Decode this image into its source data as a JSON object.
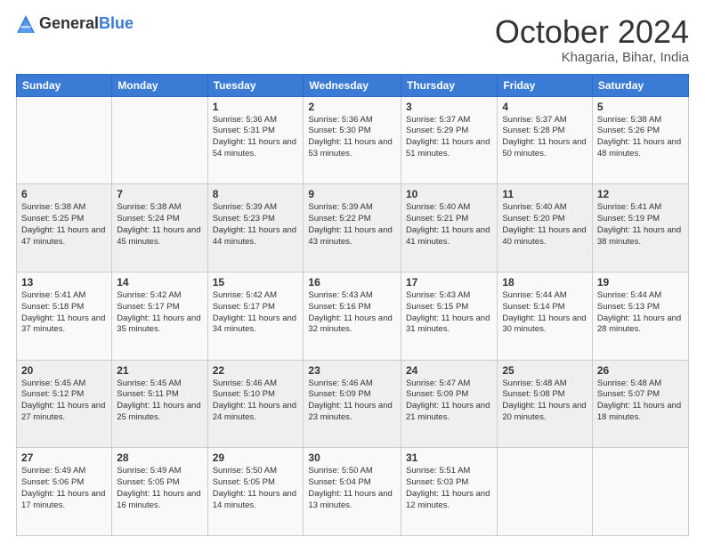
{
  "header": {
    "logo_general": "General",
    "logo_blue": "Blue",
    "month_title": "October 2024",
    "location": "Khagaria, Bihar, India"
  },
  "days_of_week": [
    "Sunday",
    "Monday",
    "Tuesday",
    "Wednesday",
    "Thursday",
    "Friday",
    "Saturday"
  ],
  "weeks": [
    [
      {
        "day": "",
        "info": ""
      },
      {
        "day": "",
        "info": ""
      },
      {
        "day": "1",
        "info": "Sunrise: 5:36 AM\nSunset: 5:31 PM\nDaylight: 11 hours and 54 minutes."
      },
      {
        "day": "2",
        "info": "Sunrise: 5:36 AM\nSunset: 5:30 PM\nDaylight: 11 hours and 53 minutes."
      },
      {
        "day": "3",
        "info": "Sunrise: 5:37 AM\nSunset: 5:29 PM\nDaylight: 11 hours and 51 minutes."
      },
      {
        "day": "4",
        "info": "Sunrise: 5:37 AM\nSunset: 5:28 PM\nDaylight: 11 hours and 50 minutes."
      },
      {
        "day": "5",
        "info": "Sunrise: 5:38 AM\nSunset: 5:26 PM\nDaylight: 11 hours and 48 minutes."
      }
    ],
    [
      {
        "day": "6",
        "info": "Sunrise: 5:38 AM\nSunset: 5:25 PM\nDaylight: 11 hours and 47 minutes."
      },
      {
        "day": "7",
        "info": "Sunrise: 5:38 AM\nSunset: 5:24 PM\nDaylight: 11 hours and 45 minutes."
      },
      {
        "day": "8",
        "info": "Sunrise: 5:39 AM\nSunset: 5:23 PM\nDaylight: 11 hours and 44 minutes."
      },
      {
        "day": "9",
        "info": "Sunrise: 5:39 AM\nSunset: 5:22 PM\nDaylight: 11 hours and 43 minutes."
      },
      {
        "day": "10",
        "info": "Sunrise: 5:40 AM\nSunset: 5:21 PM\nDaylight: 11 hours and 41 minutes."
      },
      {
        "day": "11",
        "info": "Sunrise: 5:40 AM\nSunset: 5:20 PM\nDaylight: 11 hours and 40 minutes."
      },
      {
        "day": "12",
        "info": "Sunrise: 5:41 AM\nSunset: 5:19 PM\nDaylight: 11 hours and 38 minutes."
      }
    ],
    [
      {
        "day": "13",
        "info": "Sunrise: 5:41 AM\nSunset: 5:18 PM\nDaylight: 11 hours and 37 minutes."
      },
      {
        "day": "14",
        "info": "Sunrise: 5:42 AM\nSunset: 5:17 PM\nDaylight: 11 hours and 35 minutes."
      },
      {
        "day": "15",
        "info": "Sunrise: 5:42 AM\nSunset: 5:17 PM\nDaylight: 11 hours and 34 minutes."
      },
      {
        "day": "16",
        "info": "Sunrise: 5:43 AM\nSunset: 5:16 PM\nDaylight: 11 hours and 32 minutes."
      },
      {
        "day": "17",
        "info": "Sunrise: 5:43 AM\nSunset: 5:15 PM\nDaylight: 11 hours and 31 minutes."
      },
      {
        "day": "18",
        "info": "Sunrise: 5:44 AM\nSunset: 5:14 PM\nDaylight: 11 hours and 30 minutes."
      },
      {
        "day": "19",
        "info": "Sunrise: 5:44 AM\nSunset: 5:13 PM\nDaylight: 11 hours and 28 minutes."
      }
    ],
    [
      {
        "day": "20",
        "info": "Sunrise: 5:45 AM\nSunset: 5:12 PM\nDaylight: 11 hours and 27 minutes."
      },
      {
        "day": "21",
        "info": "Sunrise: 5:45 AM\nSunset: 5:11 PM\nDaylight: 11 hours and 25 minutes."
      },
      {
        "day": "22",
        "info": "Sunrise: 5:46 AM\nSunset: 5:10 PM\nDaylight: 11 hours and 24 minutes."
      },
      {
        "day": "23",
        "info": "Sunrise: 5:46 AM\nSunset: 5:09 PM\nDaylight: 11 hours and 23 minutes."
      },
      {
        "day": "24",
        "info": "Sunrise: 5:47 AM\nSunset: 5:09 PM\nDaylight: 11 hours and 21 minutes."
      },
      {
        "day": "25",
        "info": "Sunrise: 5:48 AM\nSunset: 5:08 PM\nDaylight: 11 hours and 20 minutes."
      },
      {
        "day": "26",
        "info": "Sunrise: 5:48 AM\nSunset: 5:07 PM\nDaylight: 11 hours and 18 minutes."
      }
    ],
    [
      {
        "day": "27",
        "info": "Sunrise: 5:49 AM\nSunset: 5:06 PM\nDaylight: 11 hours and 17 minutes."
      },
      {
        "day": "28",
        "info": "Sunrise: 5:49 AM\nSunset: 5:05 PM\nDaylight: 11 hours and 16 minutes."
      },
      {
        "day": "29",
        "info": "Sunrise: 5:50 AM\nSunset: 5:05 PM\nDaylight: 11 hours and 14 minutes."
      },
      {
        "day": "30",
        "info": "Sunrise: 5:50 AM\nSunset: 5:04 PM\nDaylight: 11 hours and 13 minutes."
      },
      {
        "day": "31",
        "info": "Sunrise: 5:51 AM\nSunset: 5:03 PM\nDaylight: 11 hours and 12 minutes."
      },
      {
        "day": "",
        "info": ""
      },
      {
        "day": "",
        "info": ""
      }
    ]
  ]
}
